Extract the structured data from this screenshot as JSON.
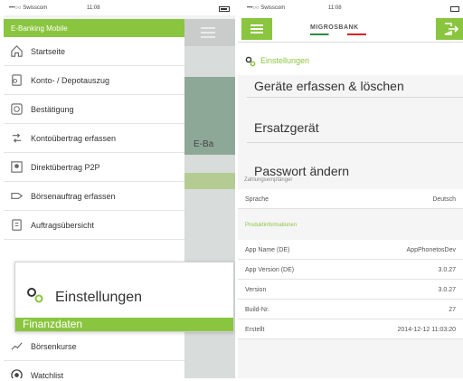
{
  "left": {
    "status": {
      "carrier": "•••○○ Swisscom",
      "time": "11:08"
    },
    "menu_header": "E-Banking Mobile",
    "menu_items": [
      {
        "label": "Startseite",
        "icon": "home-icon"
      },
      {
        "label": "Konto- / Depotauszug",
        "icon": "statement-icon"
      },
      {
        "label": "Bestätigung",
        "icon": "confirmation-icon"
      },
      {
        "label": "Kontoübertrag erfassen",
        "icon": "transfer-icon"
      },
      {
        "label": "Direktübertrag P2P",
        "icon": "p2p-icon"
      },
      {
        "label": "Börsenauftrag erfassen",
        "icon": "stock-order-icon"
      },
      {
        "label": "Auftragsübersicht",
        "icon": "orders-icon"
      }
    ],
    "peek_title": "E-Ba",
    "zoom": {
      "label": "Einstellungen",
      "section": "Finanzdaten"
    },
    "menu_after": [
      {
        "label": "Börsenkurse",
        "icon": "chart-line-icon"
      },
      {
        "label": "Watchlist",
        "icon": "watchlist-icon"
      }
    ]
  },
  "right": {
    "status": {
      "carrier": "•••○○ Swisscom",
      "time": "11:08"
    },
    "brand": "MIGROSBANK",
    "settings_title": "Einstellungen",
    "options": [
      "Geräte erfassen & löschen",
      "Ersatzgerät",
      "Passwort ändern"
    ],
    "cut_label": "Zahlungsempfänger",
    "language": {
      "key": "Sprache",
      "value": "Deutsch"
    },
    "product_section": "Produktinformationen",
    "product_rows": [
      {
        "key": "App Name (DE)",
        "value": "AppPhonetosDev"
      },
      {
        "key": "App Version (DE)",
        "value": "3.0.27"
      },
      {
        "key": "Version",
        "value": "3.0.27"
      },
      {
        "key": "Build-Nr.",
        "value": "27"
      },
      {
        "key": "Erstellt",
        "value": "2014-12-12 11:03:20"
      }
    ]
  },
  "colors": {
    "accent": "#8ac53f"
  }
}
